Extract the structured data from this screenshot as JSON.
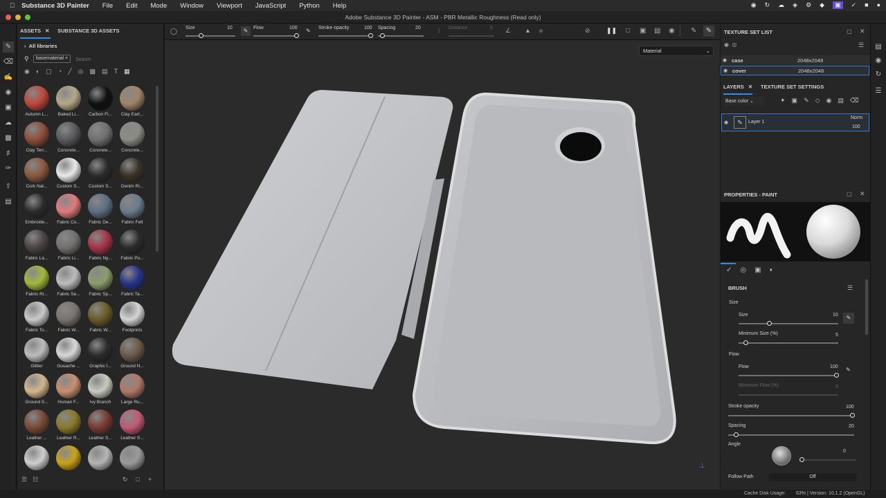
{
  "menubar": {
    "app": "Substance 3D Painter",
    "items": [
      "File",
      "Edit",
      "Mode",
      "Window",
      "Viewport",
      "JavaScript",
      "Python",
      "Help"
    ]
  },
  "window_title": "Adobe Substance 3D Painter - ASM - PBR Metallic Roughness (Read only)",
  "assets": {
    "tab_assets": "ASSETS",
    "tab_s3d": "SUBSTANCE 3D ASSETS",
    "all_libraries": "All libraries",
    "filter_chip": "basematerial",
    "search_placeholder": "Search",
    "items": [
      {
        "label": "Autumn L...",
        "color": "#c0473a"
      },
      {
        "label": "Baked Li...",
        "color": "#b6a788"
      },
      {
        "label": "Carbon Fi...",
        "color": "#101010"
      },
      {
        "label": "Clay Eart...",
        "color": "#a08468"
      },
      {
        "label": "Clay Terr...",
        "color": "#8e4e3a"
      },
      {
        "label": "Concrete...",
        "color": "#5a5a5c"
      },
      {
        "label": "Concrete...",
        "color": "#707070"
      },
      {
        "label": "Concrete...",
        "color": "#8b8b85"
      },
      {
        "label": "Cork Nat...",
        "color": "#8b5a3e"
      },
      {
        "label": "Custom S...",
        "color": "#e9e9e9"
      },
      {
        "label": "Custom S...",
        "color": "#2b2b2b"
      },
      {
        "label": "Denim Ri...",
        "color": "#3a3228"
      },
      {
        "label": "Embroide...",
        "color": "#2b2b2b"
      },
      {
        "label": "Fabric Co...",
        "color": "#e27a7c"
      },
      {
        "label": "Fabric De...",
        "color": "#5e6e84"
      },
      {
        "label": "Fabric Felt",
        "color": "#6c7b8c"
      },
      {
        "label": "Fabric La...",
        "color": "#4c4444"
      },
      {
        "label": "Fabric Li...",
        "color": "#747070"
      },
      {
        "label": "Fabric Ny...",
        "color": "#a8324a"
      },
      {
        "label": "Fabric Pu...",
        "color": "#2b2b2b"
      },
      {
        "label": "Fabric Ri...",
        "color": "#a2b83c"
      },
      {
        "label": "Fabric Se...",
        "color": "#bcbcbc"
      },
      {
        "label": "Fabric Sp...",
        "color": "#8c9c6a"
      },
      {
        "label": "Fabric Ta...",
        "color": "#26348a"
      },
      {
        "label": "Fabric To...",
        "color": "#c9c9c9"
      },
      {
        "label": "Fabric W...",
        "color": "#7a7470"
      },
      {
        "label": "Fabric W...",
        "color": "#6a5c26"
      },
      {
        "label": "Footprints",
        "color": "#d4d4d4"
      },
      {
        "label": "Glitter",
        "color": "#bdbdbd"
      },
      {
        "label": "Gouache ...",
        "color": "#d8d8d8"
      },
      {
        "label": "Graphic I...",
        "color": "#2b2b2b"
      },
      {
        "label": "Ground N...",
        "color": "#6b5a4a"
      },
      {
        "label": "Ground S...",
        "color": "#d4b68e"
      },
      {
        "label": "Human F...",
        "color": "#c98e70"
      },
      {
        "label": "Ivy Branch",
        "color": "#c8cbbf"
      },
      {
        "label": "Large Ru...",
        "color": "#b07868"
      },
      {
        "label": "Leather ...",
        "color": "#7a4a36"
      },
      {
        "label": "Leather R...",
        "color": "#8a7a2a"
      },
      {
        "label": "Leather S...",
        "color": "#7a3a30"
      },
      {
        "label": "Leather S...",
        "color": "#c25a76"
      },
      {
        "label": "",
        "color": "#cfcfcf"
      },
      {
        "label": "",
        "color": "#c9a21a"
      },
      {
        "label": "",
        "color": "#b5b5b5"
      },
      {
        "label": "",
        "color": "#9a9a9a"
      }
    ]
  },
  "toolbar": {
    "size_label": "Size",
    "size_val": "10",
    "flow_label": "Flow",
    "flow_val": "100",
    "stroke_label": "Stroke opacity",
    "stroke_val": "100",
    "spacing_label": "Spacing",
    "spacing_val": "20",
    "distance_label": "Distance",
    "distance_val": "8"
  },
  "viewport": {
    "mode_select": "Material"
  },
  "texture_set": {
    "title": "TEXTURE SET LIST",
    "rows": [
      {
        "name": "case",
        "res": "2048x2048"
      },
      {
        "name": "cover",
        "res": "2048x2048"
      }
    ]
  },
  "layers": {
    "tab_layers": "LAYERS",
    "tab_settings": "TEXTURE SET SETTINGS",
    "channel": "Base color",
    "layer_name": "Layer 1",
    "blend": "Norm",
    "opacity": "100"
  },
  "properties": {
    "title": "PROPERTIES - PAINT",
    "brush": "BRUSH",
    "size_section": "Size",
    "size_label": "Size",
    "size_val": "10",
    "min_size_label": "Minimum Size (%)",
    "min_size_val": "5",
    "flow_section": "Flow",
    "flow_label": "Flow",
    "flow_val": "100",
    "min_flow_label": "Minimum Flow (%)",
    "min_flow_val": "5",
    "stroke_label": "Stroke opacity",
    "stroke_val": "100",
    "spacing_label": "Spacing",
    "spacing_val": "20",
    "angle_label": "Angle",
    "angle_val": "0",
    "follow_label": "Follow Path",
    "follow_val": "Off"
  },
  "status": {
    "cache": "Cache Disk Usage:",
    "usage": "63% | Version: 10.1.2 (OpenGL)"
  }
}
